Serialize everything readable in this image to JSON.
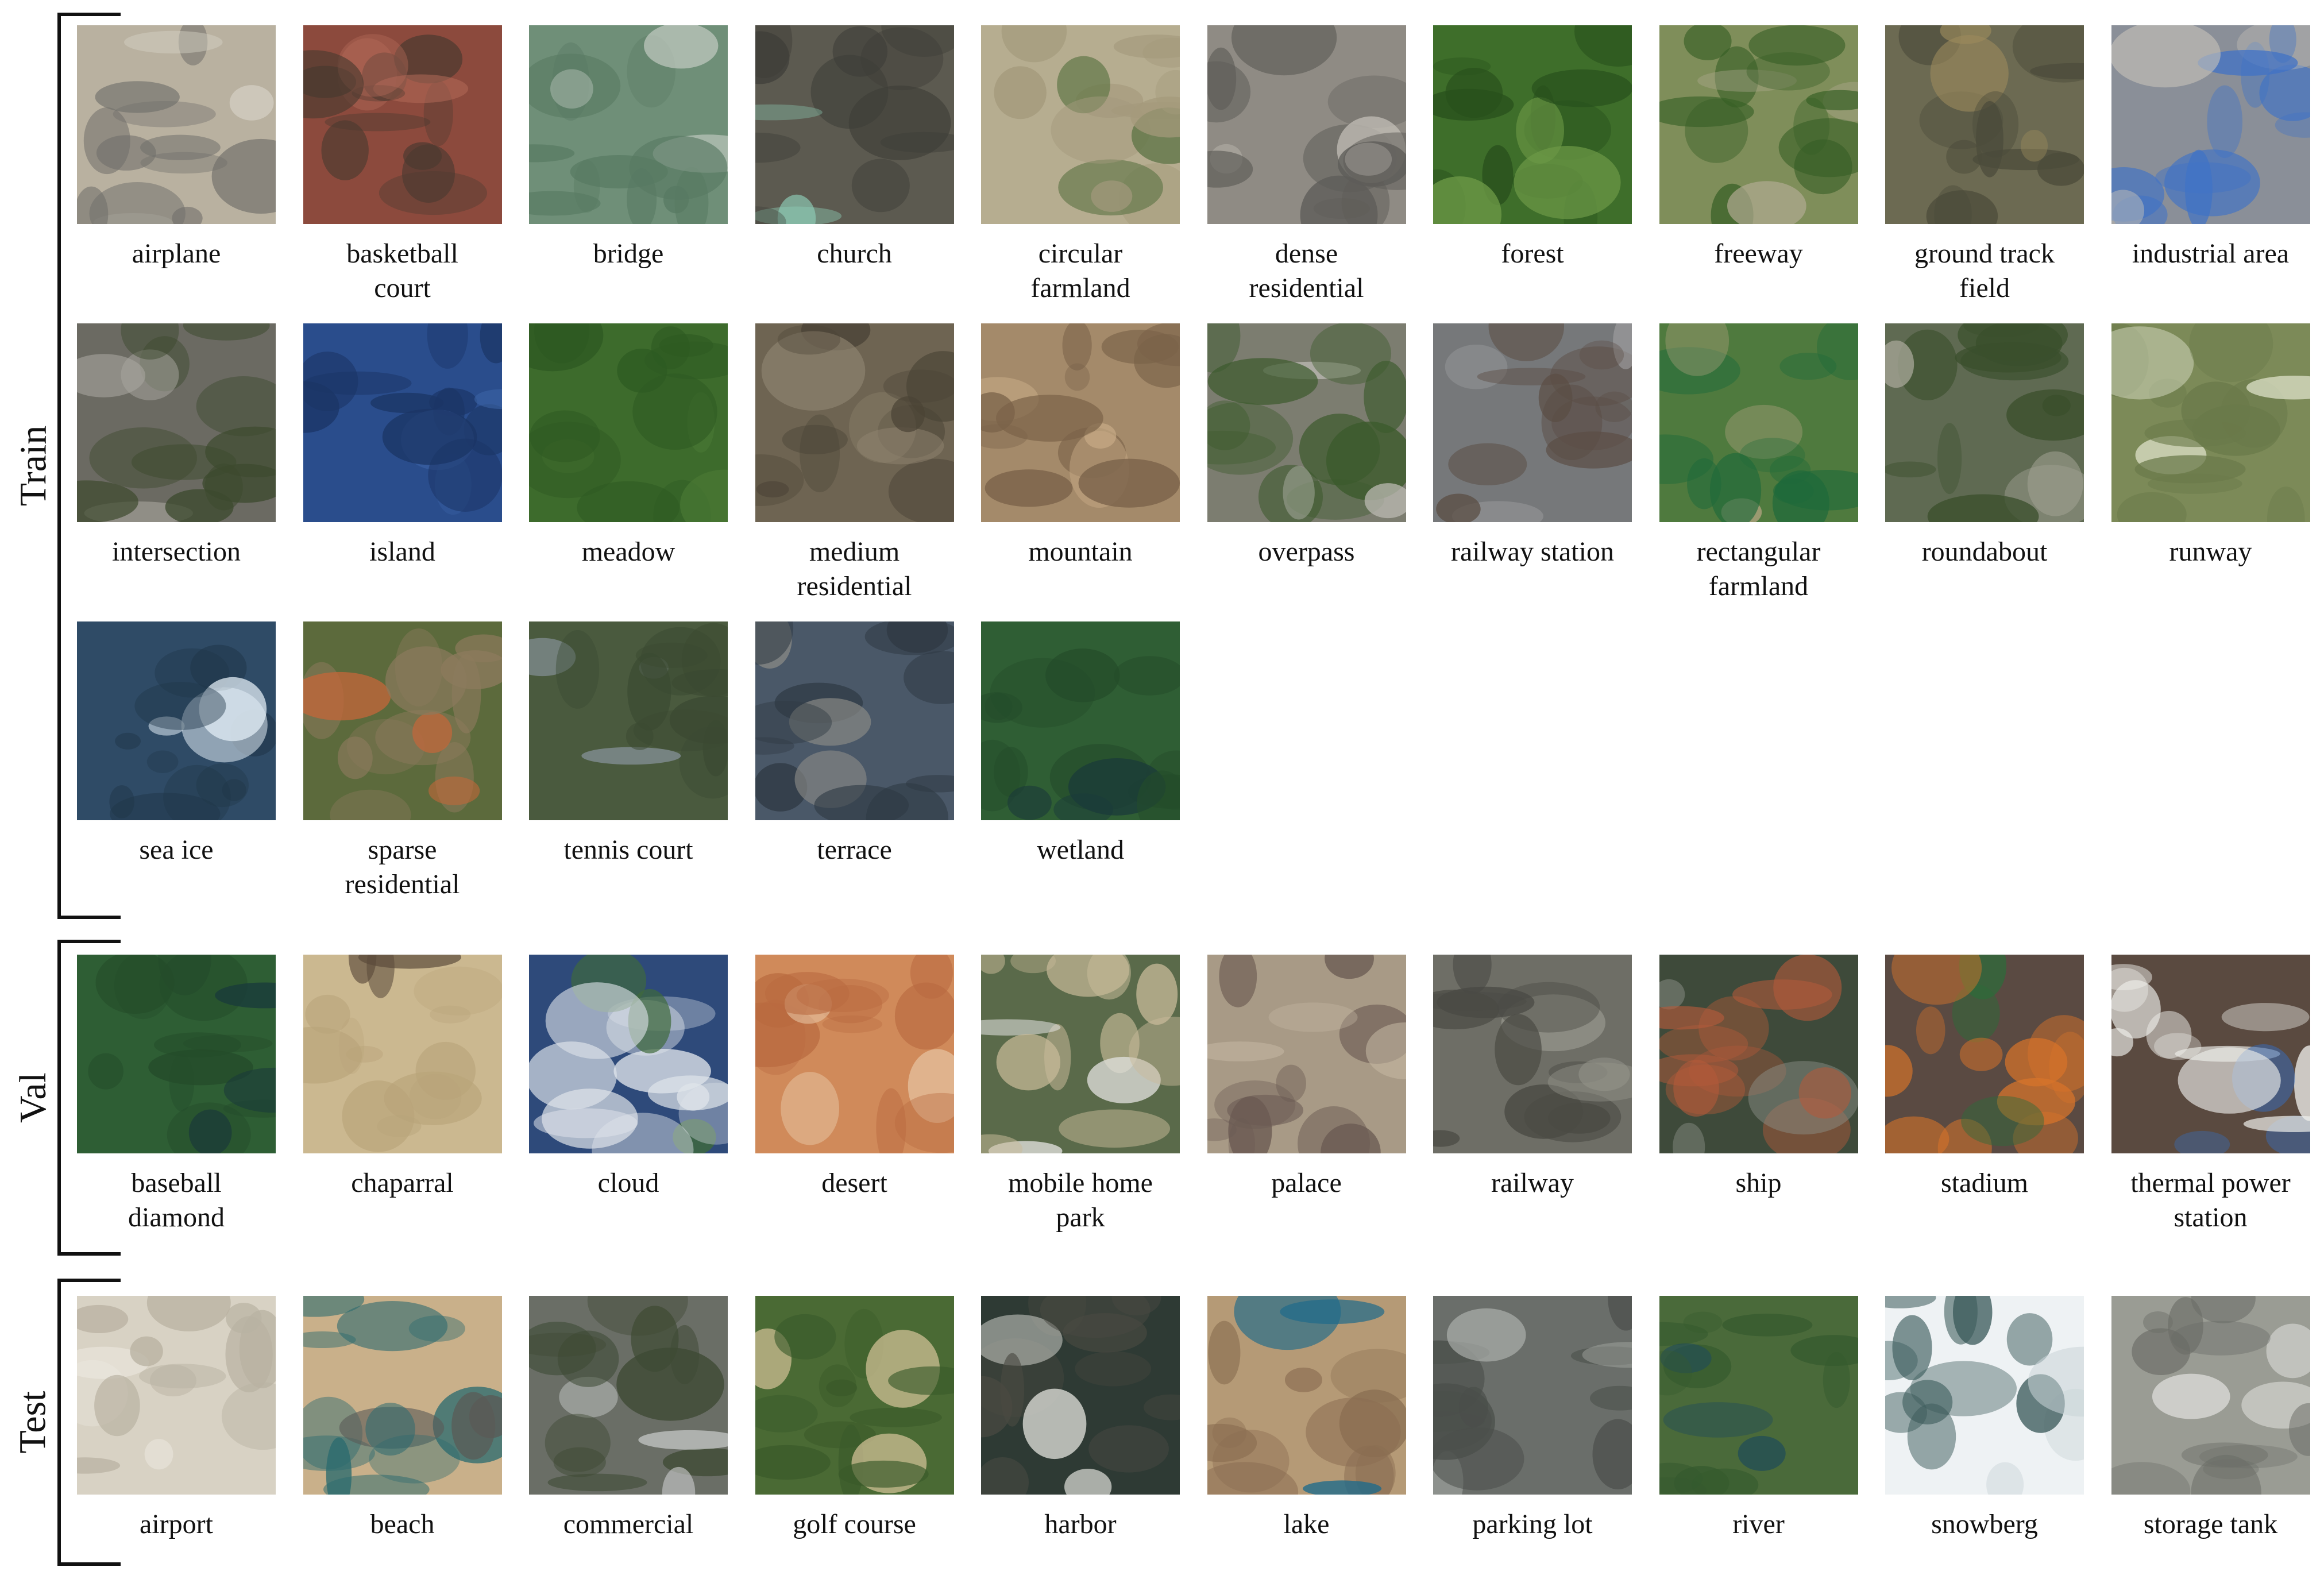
{
  "sections": {
    "train": {
      "label": "Train",
      "items": [
        {
          "caption": "airplane",
          "colors": [
            "#b9b1a0",
            "#6e6d69",
            "#d7d2c6"
          ]
        },
        {
          "caption": "basketball\ncourt",
          "colors": [
            "#8c4a3d",
            "#4b3a30",
            "#b36a58"
          ]
        },
        {
          "caption": "bridge",
          "colors": [
            "#6f8f78",
            "#587a63",
            "#c9d0c8"
          ]
        },
        {
          "caption": "church",
          "colors": [
            "#5c5a50",
            "#3e3d38",
            "#8fd0b8"
          ]
        },
        {
          "caption": "circular\nfarmland",
          "colors": [
            "#b6ad90",
            "#a49a7c",
            "#5f7546"
          ]
        },
        {
          "caption": "dense\nresidential",
          "colors": [
            "#8f8b84",
            "#5e5c58",
            "#c3bfb7"
          ]
        },
        {
          "caption": "forest",
          "colors": [
            "#3e6e2a",
            "#28501c",
            "#6c9846"
          ]
        },
        {
          "caption": "freeway",
          "colors": [
            "#7f8e5a",
            "#355e24",
            "#b2ab92"
          ]
        },
        {
          "caption": "ground track\nfield",
          "colors": [
            "#6c6a52",
            "#4b4b3a",
            "#9b8a5c"
          ]
        },
        {
          "caption": "industrial area",
          "colors": [
            "#8a8f98",
            "#3f72c6",
            "#c7c2b8"
          ]
        },
        {
          "caption": "intersection",
          "colors": [
            "#6b6a62",
            "#3d4a2e",
            "#a9a79f"
          ]
        },
        {
          "caption": "island",
          "colors": [
            "#2a4d8c",
            "#1b3566",
            "#3d65a8"
          ]
        },
        {
          "caption": "meadow",
          "colors": [
            "#3d6b2c",
            "#2e5a22",
            "#4c7a36"
          ]
        },
        {
          "caption": "medium\nresidential",
          "colors": [
            "#6e6452",
            "#4a4336",
            "#8f8470"
          ]
        },
        {
          "caption": "mountain",
          "colors": [
            "#a48a6a",
            "#7a6249",
            "#c7ab86"
          ]
        },
        {
          "caption": "overpass",
          "colors": [
            "#7c7d70",
            "#3c5a2c",
            "#b9b8b0"
          ]
        },
        {
          "caption": "railway station",
          "colors": [
            "#76787a",
            "#5b4d44",
            "#a5a6a8"
          ]
        },
        {
          "caption": "rectangular\nfarmland",
          "colors": [
            "#4f7a3e",
            "#1f6a3a",
            "#b0a27f"
          ]
        },
        {
          "caption": "roundabout",
          "colors": [
            "#5f6a52",
            "#3a4f2c",
            "#a2a294"
          ]
        },
        {
          "caption": "runway",
          "colors": [
            "#7c8a58",
            "#6a7a4a",
            "#dadfc6"
          ]
        },
        {
          "caption": "sea ice",
          "colors": [
            "#2f4b66",
            "#203648",
            "#e3eef5"
          ]
        },
        {
          "caption": "sparse\nresidential",
          "colors": [
            "#5c6a3c",
            "#8c7a5c",
            "#c4673a"
          ]
        },
        {
          "caption": "tennis court",
          "colors": [
            "#4a5a3e",
            "#3b4a32",
            "#8c97a0"
          ]
        },
        {
          "caption": "terrace",
          "colors": [
            "#4a5868",
            "#2f3a44",
            "#8a8a86"
          ]
        },
        {
          "caption": "wetland",
          "colors": [
            "#2f5e34",
            "#244c2a",
            "#1a3a3a"
          ]
        }
      ]
    },
    "val": {
      "label": "Val",
      "items": [
        {
          "caption": "baseball\ndiamond",
          "colors": [
            "#2e5e34",
            "#244c2a",
            "#1a3a3a"
          ]
        },
        {
          "caption": "chaparral",
          "colors": [
            "#cbb890",
            "#b9a47a",
            "#5a4a3a"
          ]
        },
        {
          "caption": "cloud",
          "colors": [
            "#2e4a7a",
            "#dfe4ea",
            "#3f6a3a"
          ]
        },
        {
          "caption": "desert",
          "colors": [
            "#d08a5a",
            "#b96a40",
            "#e6c3a0"
          ]
        },
        {
          "caption": "mobile home\npark",
          "colors": [
            "#5a6a4a",
            "#c9bb9a",
            "#e0e0dc"
          ]
        },
        {
          "caption": "palace",
          "colors": [
            "#a89a86",
            "#6a5a52",
            "#c6b9a4"
          ]
        },
        {
          "caption": "railway",
          "colors": [
            "#6e6e66",
            "#4a4a44",
            "#96968c"
          ]
        },
        {
          "caption": "ship",
          "colors": [
            "#3e4a3a",
            "#b45a3a",
            "#8a8e86"
          ]
        },
        {
          "caption": "stadium",
          "colors": [
            "#5a4a42",
            "#d8742a",
            "#2e6a3a"
          ]
        },
        {
          "caption": "thermal power\nstation",
          "colors": [
            "#5a4a40",
            "#eeeeea",
            "#3a6ab0"
          ]
        }
      ]
    },
    "test": {
      "label": "Test",
      "items": [
        {
          "caption": "airport",
          "colors": [
            "#d8d2c4",
            "#b9b2a2",
            "#eeeae2"
          ]
        },
        {
          "caption": "beach",
          "colors": [
            "#c9b08a",
            "#2a6a6e",
            "#5a5a56"
          ]
        },
        {
          "caption": "commercial",
          "colors": [
            "#6a6e66",
            "#3e4a34",
            "#c6c9c8"
          ]
        },
        {
          "caption": "golf course",
          "colors": [
            "#4a6a34",
            "#3a5a2a",
            "#d6c49a"
          ]
        },
        {
          "caption": "harbor",
          "colors": [
            "#2e3a34",
            "#4a4a42",
            "#e6e6e0"
          ]
        },
        {
          "caption": "lake",
          "colors": [
            "#b59a76",
            "#8a6e52",
            "#1e6a8a"
          ]
        },
        {
          "caption": "parking lot",
          "colors": [
            "#6a6e6a",
            "#4a4e4a",
            "#b5b8b4"
          ]
        },
        {
          "caption": "river",
          "colors": [
            "#4a6a3a",
            "#355a2e",
            "#1e4a5a"
          ]
        },
        {
          "caption": "snowberg",
          "colors": [
            "#eef2f4",
            "#3a5a5a",
            "#c9d4d8"
          ]
        },
        {
          "caption": "storage tank",
          "colors": [
            "#9a9c94",
            "#6a6c66",
            "#e6e6e2"
          ]
        }
      ]
    }
  }
}
